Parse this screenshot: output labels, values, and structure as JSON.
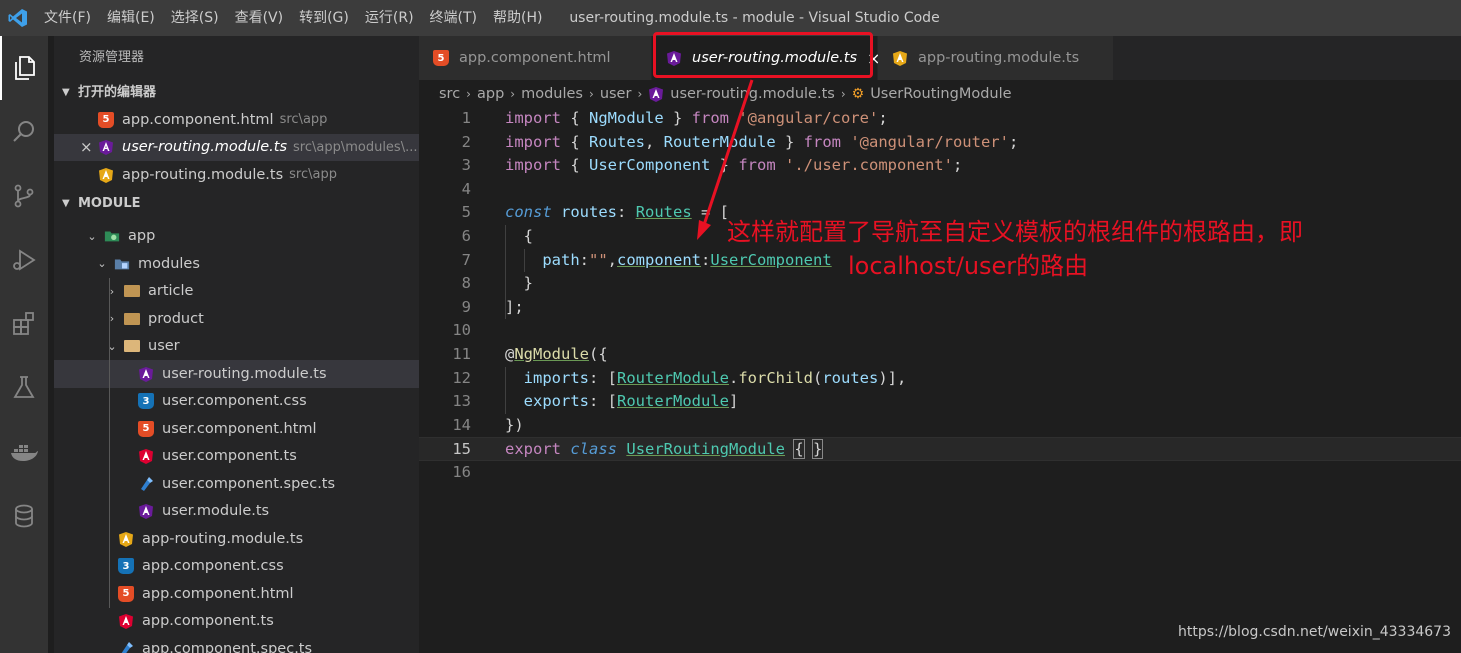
{
  "window": {
    "title": "user-routing.module.ts - module - Visual Studio Code",
    "menu": [
      "文件(F)",
      "编辑(E)",
      "选择(S)",
      "查看(V)",
      "转到(G)",
      "运行(R)",
      "终端(T)",
      "帮助(H)"
    ]
  },
  "activity_bar": [
    "explorer-icon",
    "search-icon",
    "source-control-icon",
    "run-debug-icon",
    "extensions-icon",
    "testing-icon",
    "docker-icon",
    "database-icon"
  ],
  "sidebar": {
    "title": "资源管理器",
    "open_editors_header": "打开的编辑器",
    "open_editors": [
      {
        "name": "app.component.html",
        "path": "src\\app",
        "icon": "html-file-icon"
      },
      {
        "name": "user-routing.module.ts",
        "path": "src\\app\\modules\\...",
        "icon": "angular-module-icon"
      },
      {
        "name": "app-routing.module.ts",
        "path": "src\\app",
        "icon": "angular-routing-icon"
      }
    ],
    "folder_header": "MODULE",
    "tree": [
      {
        "name": "app",
        "kind": "folder-open"
      },
      {
        "name": "modules",
        "kind": "folder-open"
      },
      {
        "name": "article",
        "kind": "folder"
      },
      {
        "name": "product",
        "kind": "folder"
      },
      {
        "name": "user",
        "kind": "folder-open"
      },
      {
        "name": "user-routing.module.ts",
        "kind": "angular-module"
      },
      {
        "name": "user.component.css",
        "kind": "css"
      },
      {
        "name": "user.component.html",
        "kind": "html"
      },
      {
        "name": "user.component.ts",
        "kind": "angular"
      },
      {
        "name": "user.component.spec.ts",
        "kind": "spec"
      },
      {
        "name": "user.module.ts",
        "kind": "angular-module"
      },
      {
        "name": "app-routing.module.ts",
        "kind": "angular-routing"
      },
      {
        "name": "app.component.css",
        "kind": "css"
      },
      {
        "name": "app.component.html",
        "kind": "html"
      },
      {
        "name": "app.component.ts",
        "kind": "angular"
      },
      {
        "name": "app.component.spec.ts",
        "kind": "spec"
      }
    ]
  },
  "tabs": [
    {
      "label": "app.component.html",
      "icon": "html-file-icon"
    },
    {
      "label": "user-routing.module.ts",
      "icon": "angular-module-icon",
      "close": "×"
    },
    {
      "label": "app-routing.module.ts",
      "icon": "angular-routing-icon"
    }
  ],
  "breadcrumb": [
    "src",
    "app",
    "modules",
    "user",
    "user-routing.module.ts",
    "UserRoutingModule"
  ],
  "code": {
    "line_numbers": [
      "1",
      "2",
      "3",
      "4",
      "5",
      "6",
      "7",
      "8",
      "9",
      "10",
      "11",
      "12",
      "13",
      "14",
      "15",
      "16"
    ],
    "l1": [
      "import",
      " { ",
      "NgModule",
      " } ",
      "from",
      " ",
      "'@angular/core'",
      ";"
    ],
    "l2": [
      "import",
      " { ",
      "Routes",
      ", ",
      "RouterModule",
      " } ",
      "from",
      " ",
      "'@angular/router'",
      ";"
    ],
    "l3": [
      "import",
      " { ",
      "UserComponent",
      " } ",
      "from",
      " ",
      "'./user.component'",
      ";"
    ],
    "l5": [
      "const",
      " ",
      "routes",
      ": ",
      "Routes",
      " = ["
    ],
    "l6": [
      "  {"
    ],
    "l7": [
      "    ",
      "path",
      ":",
      "\"\"",
      ",",
      "component",
      ":",
      "UserComponent"
    ],
    "l8": [
      "  }"
    ],
    "l9": [
      "];"
    ],
    "l11": [
      "@",
      "NgModule",
      "({"
    ],
    "l12": [
      "  ",
      "imports",
      ": [",
      "RouterModule",
      ".",
      "forChild",
      "(",
      "routes",
      ")],"
    ],
    "l13": [
      "  ",
      "exports",
      ": [",
      "RouterModule",
      "]"
    ],
    "l14": [
      "})"
    ],
    "l15": [
      "export",
      " ",
      "class",
      " ",
      "UserRoutingModule",
      " ",
      "{",
      " ",
      "}"
    ]
  },
  "annotation": {
    "line1": "这样就配置了导航至自定义模板的根组件的根路由，即",
    "line2": "localhost/user的路由",
    "color": "#e81123"
  },
  "watermark": "https://blog.csdn.net/weixin_43334673"
}
